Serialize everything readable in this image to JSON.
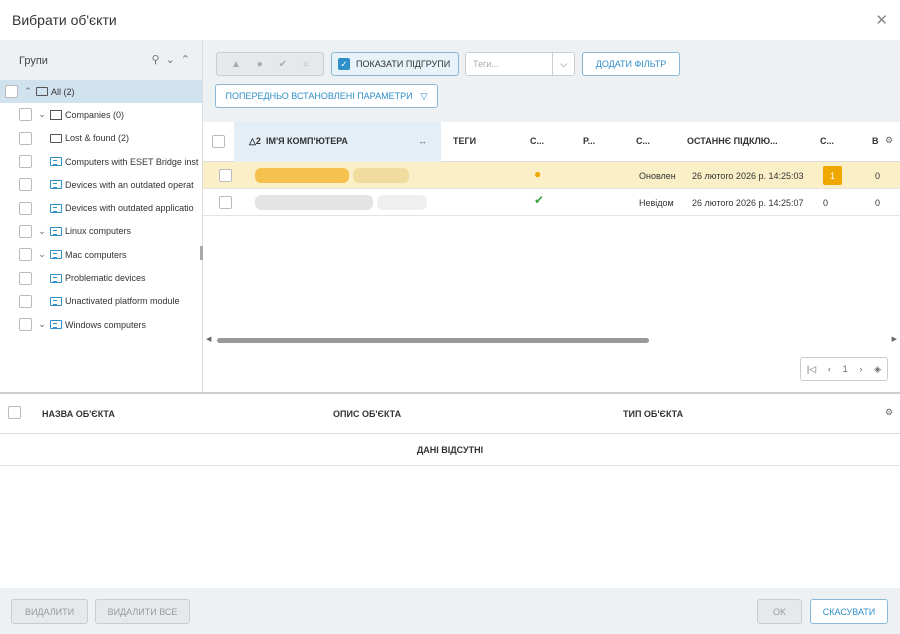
{
  "dialog": {
    "title": "Вибрати об'єкти"
  },
  "groups": {
    "title": "Групи",
    "tree": [
      {
        "label": "All (2)",
        "indent": 0,
        "chev": "^",
        "icon": "folder",
        "selected": true
      },
      {
        "label": "Companies (0)",
        "indent": 1,
        "chev": "v",
        "icon": "building",
        "selected": false
      },
      {
        "label": "Lost & found (2)",
        "indent": 2,
        "chev": "",
        "icon": "folder",
        "selected": false
      },
      {
        "label": "Computers with ESET Bridge inst",
        "indent": 2,
        "chev": "",
        "icon": "dynamic",
        "selected": false
      },
      {
        "label": "Devices with an outdated operat",
        "indent": 2,
        "chev": "",
        "icon": "dynamic",
        "selected": false
      },
      {
        "label": "Devices with outdated applicatio",
        "indent": 2,
        "chev": "",
        "icon": "dynamic",
        "selected": false
      },
      {
        "label": "Linux computers",
        "indent": 1,
        "chev": "v",
        "icon": "dynamic",
        "selected": false
      },
      {
        "label": "Mac computers",
        "indent": 1,
        "chev": "v",
        "icon": "dynamic",
        "selected": false
      },
      {
        "label": "Problematic devices",
        "indent": 2,
        "chev": "",
        "icon": "dynamic",
        "selected": false
      },
      {
        "label": "Unactivated platform module",
        "indent": 2,
        "chev": "",
        "icon": "dynamic",
        "selected": false
      },
      {
        "label": "Windows computers",
        "indent": 1,
        "chev": "v",
        "icon": "dynamic",
        "selected": false
      }
    ]
  },
  "toolbar": {
    "show_subgroups": "ПОКАЗАТИ ПІДГРУПИ",
    "tags_placeholder": "Теги...",
    "add_filter": "ДОДАТИ ФІЛЬТР",
    "presets": "ПОПЕРЕДНЬО ВСТАНОВЛЕНІ ПАРАМЕТРИ"
  },
  "table": {
    "headers": {
      "sort_index": "2",
      "name": "ІМ'Я КОМП'ЮТЕРА",
      "tags": "ТЕГИ",
      "c1": "С...",
      "c2": "Р...",
      "c3": "С...",
      "last": "ОСТАННЄ ПІДКЛЮ...",
      "c4": "С...",
      "c5": "В"
    },
    "rows": [
      {
        "status": "warning",
        "state": "Оновлен",
        "last": "26 лютого 2026 р. 14:25:03",
        "badge": "1",
        "v": "0"
      },
      {
        "status": "ok",
        "state": "Невідом",
        "last": "26 лютого 2026 р. 14:25:07",
        "badge": "0",
        "v": "0"
      }
    ],
    "page": "1"
  },
  "selected_objects": {
    "headers": {
      "name": "НАЗВА ОБ'ЄКТА",
      "desc": "ОПИС ОБ'ЄКТА",
      "type": "ТИП ОБ'ЄКТА"
    },
    "empty": "ДАНІ ВІДСУТНІ"
  },
  "footer": {
    "remove": "ВИДАЛИТИ",
    "remove_all": "ВИДАЛИТИ ВСЕ",
    "ok": "OK",
    "cancel": "СКАСУВАТИ"
  },
  "colors": {
    "accent": "#2f8fc8",
    "warning": "#f0a800",
    "ok": "#3aa63a",
    "highlight": "#fbefc7"
  }
}
